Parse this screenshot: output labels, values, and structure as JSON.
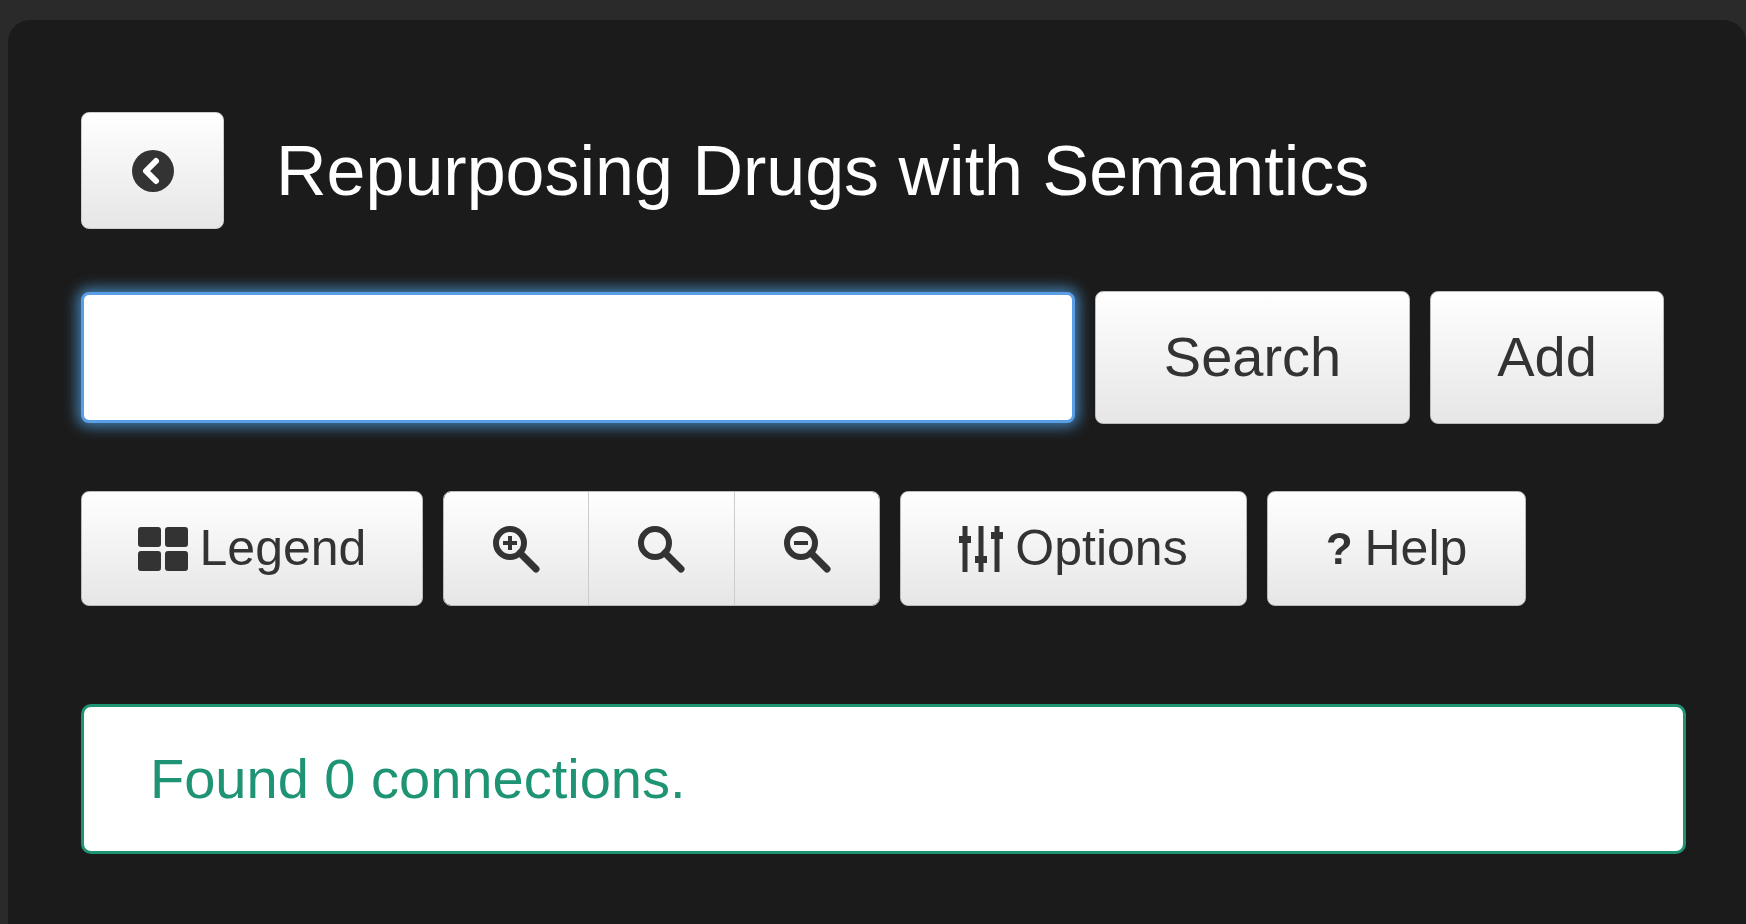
{
  "header": {
    "title": "Repurposing Drugs with Semantics"
  },
  "search": {
    "focused": true
  },
  "search_buttons": [
    "Search",
    "Add"
  ],
  "toolbar": [
    {
      "kind": "labeled",
      "label": "Legend"
    },
    {
      "kind": "zoom-group"
    },
    {
      "kind": "labeled",
      "label": "Options"
    },
    {
      "kind": "glyph",
      "glyph": "?",
      "label": "Help"
    }
  ],
  "alert": {
    "message": "Found 0 connections."
  }
}
